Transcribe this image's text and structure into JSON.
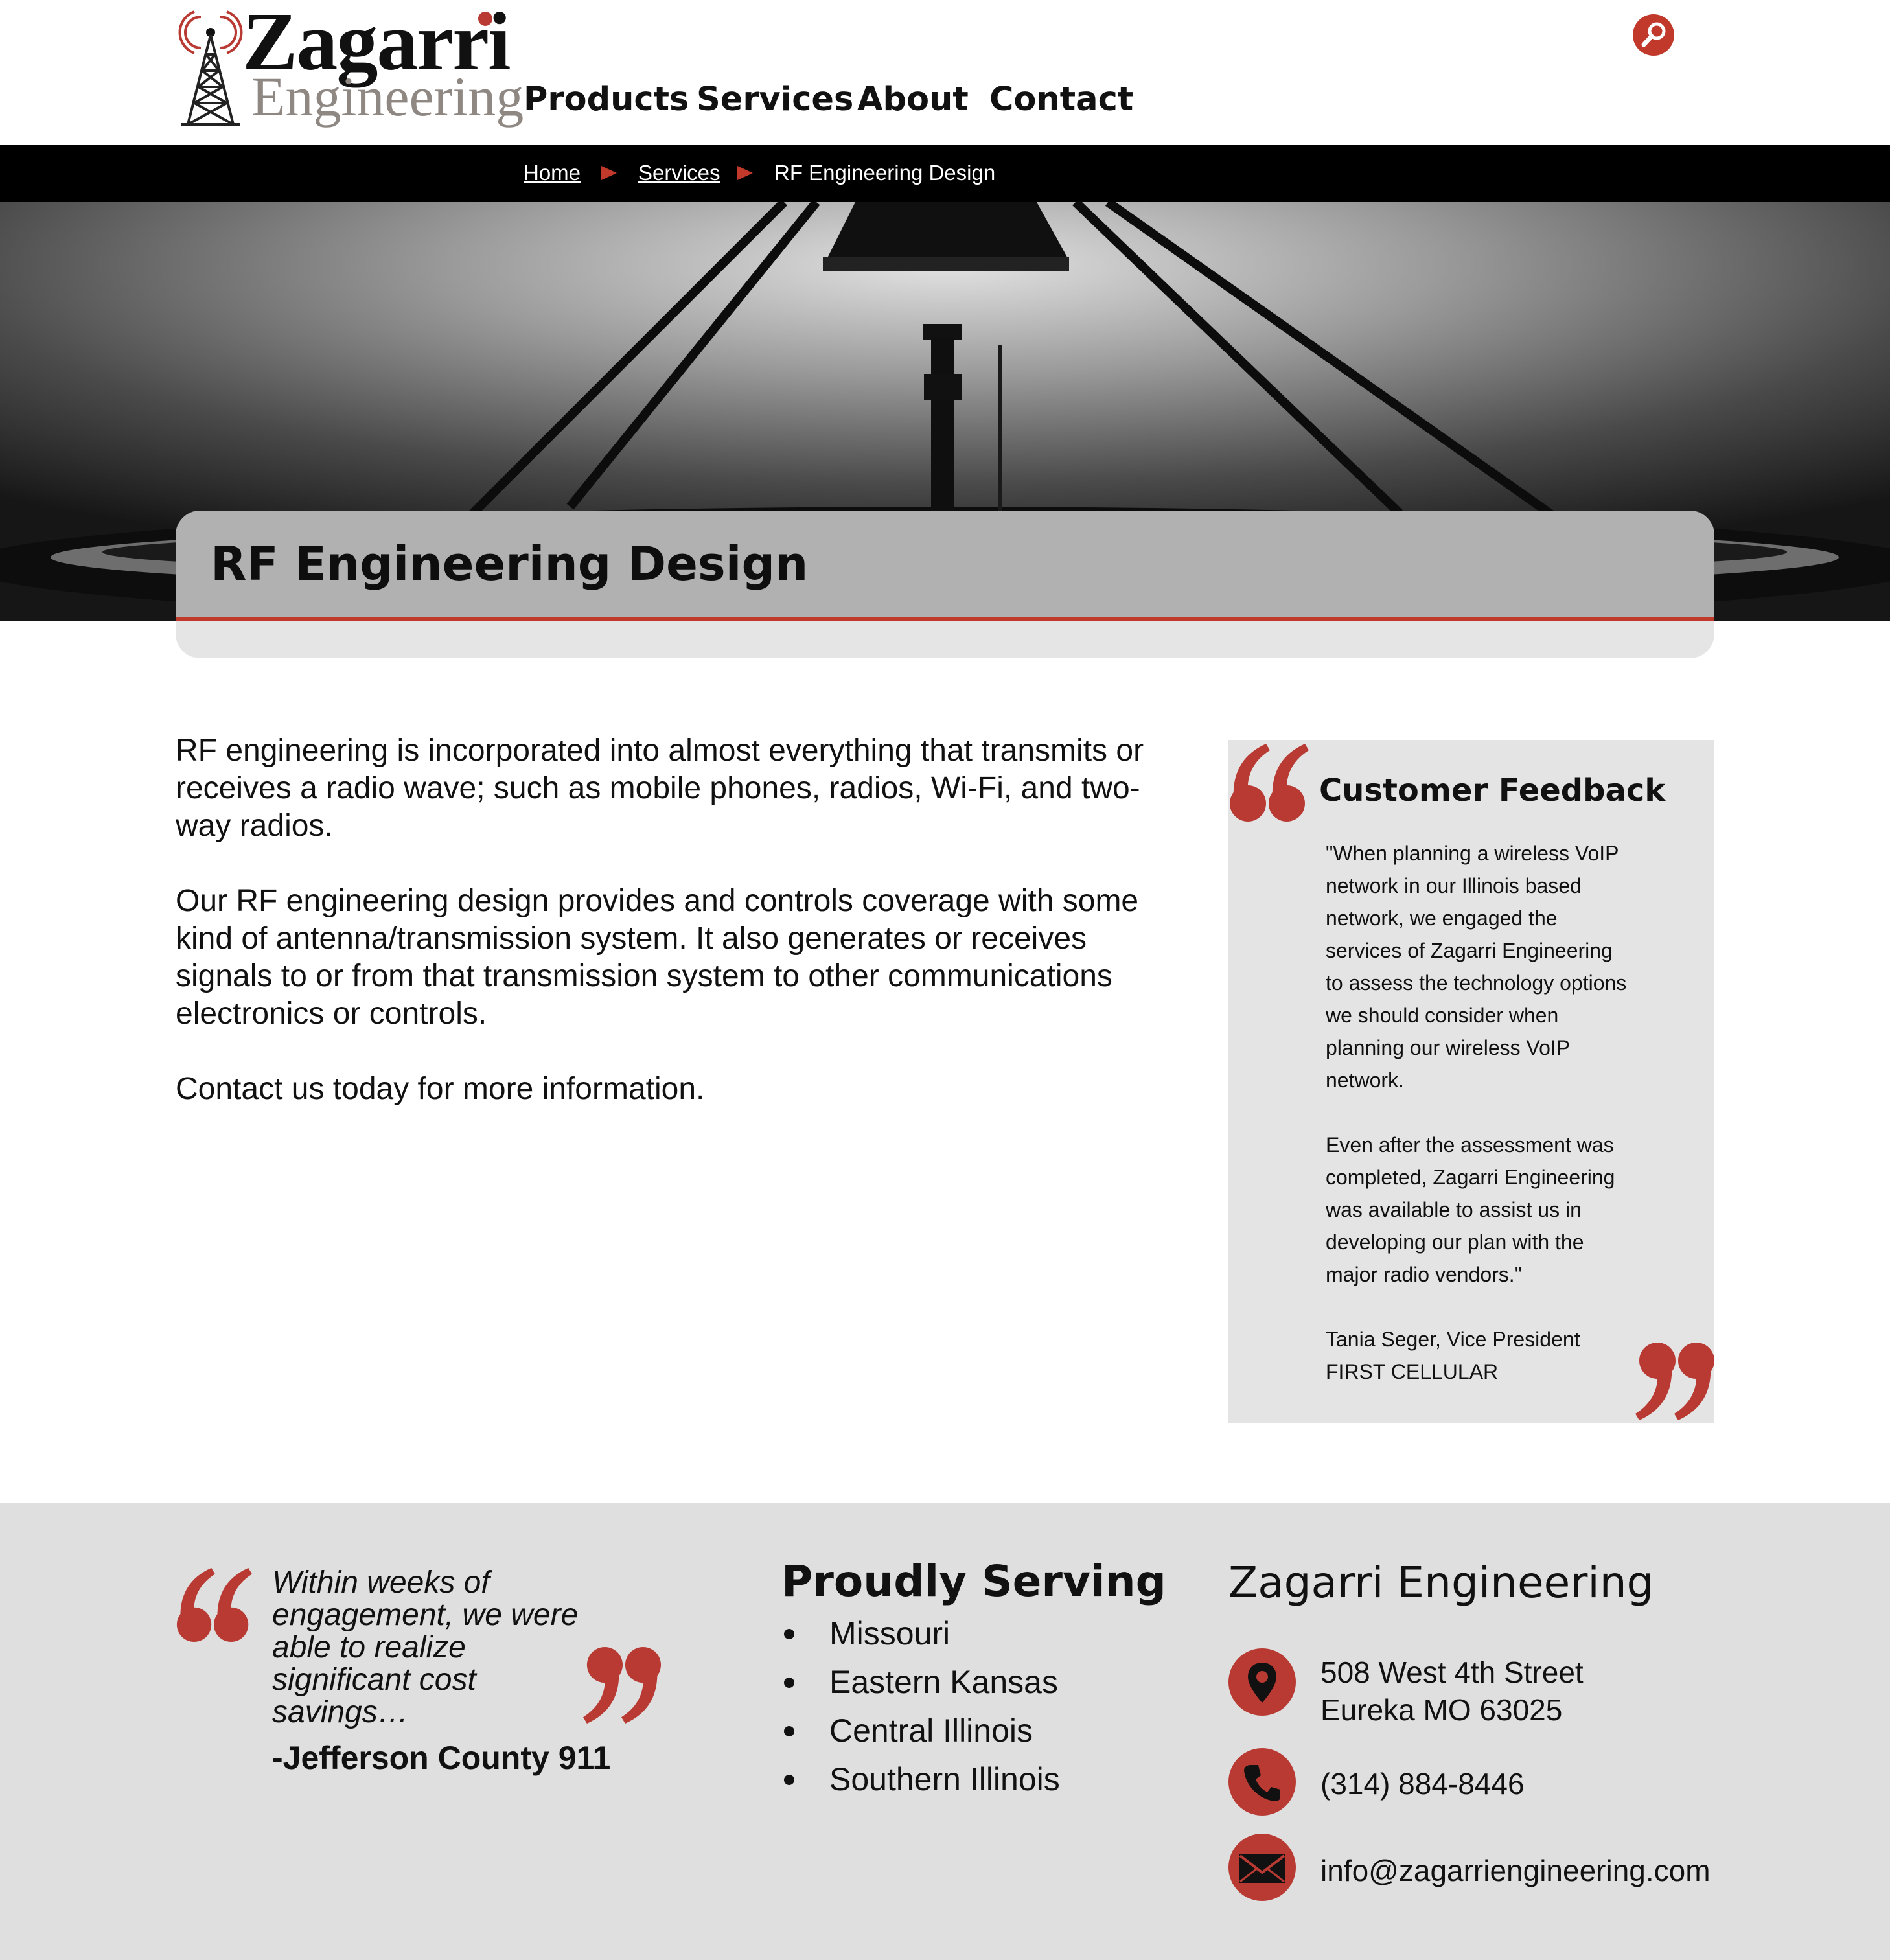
{
  "brand": {
    "name_top": "Zagarri",
    "name_bottom": "Engineering",
    "accent_color": "#c0392b"
  },
  "nav": {
    "items": [
      "Products",
      "Services",
      "About",
      "Contact"
    ]
  },
  "search": {
    "icon": "search-icon"
  },
  "breadcrumb": {
    "items": [
      "Home",
      "Services",
      "RF Engineering Design"
    ]
  },
  "page": {
    "title": "RF Engineering Design"
  },
  "body": {
    "paragraphs": [
      "RF engineering is incorporated into almost everything that transmits or receives a radio wave; such as mobile phones, radios, Wi-Fi, and two-way radios.",
      "Our RF engineering design provides and controls coverage with some kind of antenna/transmission system. It also generates or receives signals to or from that transmission system to other communications electronics or controls.",
      "Contact us today for more information."
    ]
  },
  "feedback": {
    "title": "Customer Feedback",
    "paragraphs": [
      "\"When planning a wireless VoIP network in our Illinois based network, we engaged the services of Zagarri Engineering to assess the technology options we should consider when planning our wireless VoIP network.",
      "Even after the assessment was completed, Zagarri Engineering was available to assist us in developing our plan with the major radio vendors.\""
    ],
    "author_name": "Tania Seger, Vice President",
    "author_company": "FIRST CELLULAR"
  },
  "footer": {
    "quote": "Within weeks of engagement, we were able to realize significant cost savings…",
    "quote_author": "-Jefferson County 911",
    "serving_title": "Proudly Serving",
    "serving": [
      "Missouri",
      "Eastern Kansas",
      "Central Illinois",
      "Southern Illinois"
    ],
    "company_title": "Zagarri Engineering",
    "address_line1": "508 West 4th Street",
    "address_line2": "Eureka MO 63025",
    "phone": "(314) 884-8446",
    "email": "info@zagarriengineering.com"
  }
}
